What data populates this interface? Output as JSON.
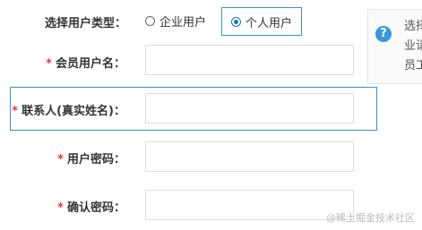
{
  "form": {
    "user_type": {
      "label": "选择用户类型：",
      "options": [
        {
          "label": "企业用户",
          "selected": false
        },
        {
          "label": "个人用户",
          "selected": true
        }
      ]
    },
    "username": {
      "required_mark": "*",
      "label": "会员用户名：",
      "value": ""
    },
    "contact": {
      "required_mark": "*",
      "label": "联系人(真实姓名)：",
      "value": ""
    },
    "password": {
      "required_mark": "*",
      "label": "用户密码：",
      "value": ""
    },
    "confirm_password": {
      "required_mark": "*",
      "label": "确认密码：",
      "value": ""
    }
  },
  "tooltip": {
    "icon": "question-icon",
    "lines": [
      "选择",
      "业请",
      "员工"
    ]
  },
  "watermark": "@稀土掘金技术社区",
  "colors": {
    "accent": "#3c92cf",
    "required": "#e4393c",
    "icon_bg": "#3a97d9"
  }
}
